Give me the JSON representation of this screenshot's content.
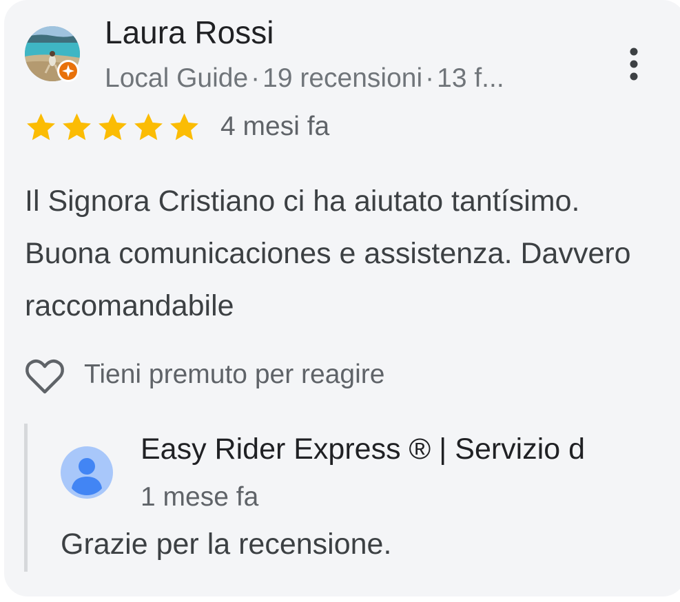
{
  "review": {
    "reviewer_name": "Laura Rossi",
    "reviewer_badge": "Local Guide",
    "reviewer_reviews": "19 recensioni",
    "reviewer_photos": "13 f...",
    "meta_separator": "·",
    "rating": 5,
    "rating_max": 5,
    "date": "4 mesi fa",
    "text": "Il Signora Cristiano ci ha aiutato tantísimo. Buona comunicaciones e assistenza. Davvero raccomandabile",
    "react_label": "Tieni premuto per reagire"
  },
  "owner_reply": {
    "name": "Easy Rider Express ® | Servizio d",
    "date": "1 mese fa",
    "text": "Grazie per la recensione."
  },
  "icons": {
    "more": "more-vert-icon",
    "heart": "heart-outline-icon",
    "star": "star-icon",
    "badge": "local-guide-badge-icon",
    "owner_avatar": "person-avatar-icon"
  },
  "colors": {
    "card_background": "#f4f5f7",
    "star": "#fbbc04",
    "badge": "#e8710a",
    "owner_avatar_bg": "#a8c7fa",
    "owner_avatar_fg": "#4285f4",
    "reply_bar": "#d6d8db"
  }
}
